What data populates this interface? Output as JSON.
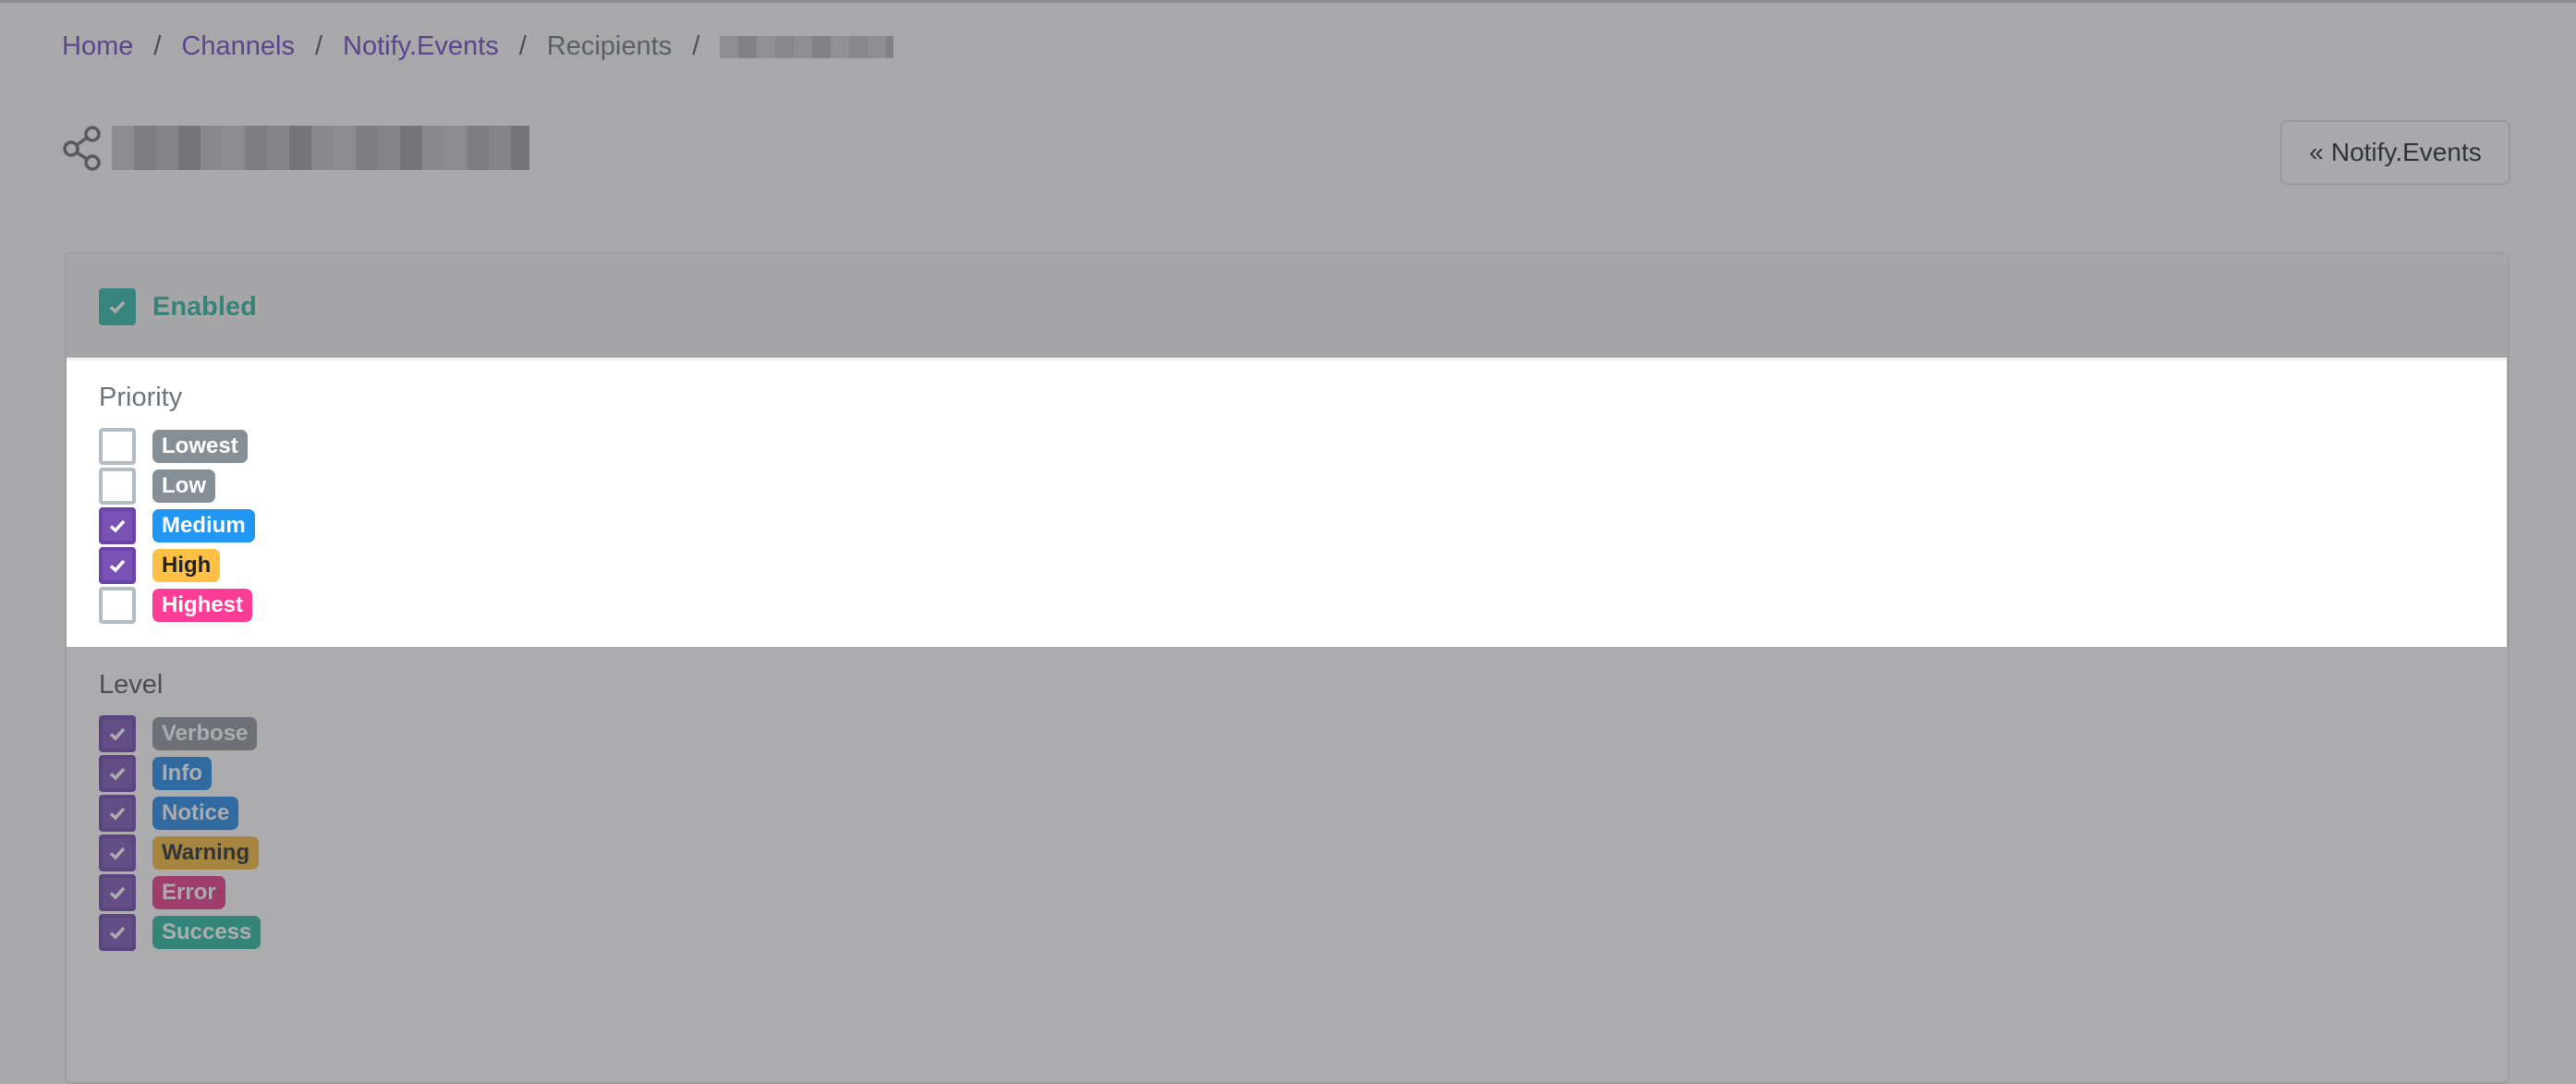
{
  "breadcrumb": {
    "items": [
      {
        "label": "Home",
        "link": true
      },
      {
        "label": "Channels",
        "link": true
      },
      {
        "label": "Notify.Events",
        "link": true
      },
      {
        "label": "Recipients",
        "link": false
      }
    ],
    "separator": "/"
  },
  "header": {
    "icon": "share-icon",
    "back_button_label": "Notify.Events",
    "back_button_icon": "«"
  },
  "card": {
    "enabled": {
      "label": "Enabled",
      "checked": true,
      "color": "#2ab9a4"
    },
    "priority": {
      "title": "Priority",
      "options": [
        {
          "label": "Lowest",
          "checked": false,
          "color": "#868e96",
          "text_color": "#ffffff"
        },
        {
          "label": "Low",
          "checked": false,
          "color": "#868e96",
          "text_color": "#ffffff"
        },
        {
          "label": "Medium",
          "checked": true,
          "color": "#2196f3",
          "text_color": "#ffffff"
        },
        {
          "label": "High",
          "checked": true,
          "color": "#ffc145",
          "text_color": "#212529"
        },
        {
          "label": "Highest",
          "checked": false,
          "color": "#ff3d97",
          "text_color": "#ffffff"
        }
      ]
    },
    "level": {
      "title": "Level",
      "options": [
        {
          "label": "Verbose",
          "checked": true,
          "color": "#8c949b",
          "text_color": "#ffffff"
        },
        {
          "label": "Info",
          "checked": true,
          "color": "#1e88e5",
          "text_color": "#ffffff"
        },
        {
          "label": "Notice",
          "checked": true,
          "color": "#1e88e5",
          "text_color": "#ffffff"
        },
        {
          "label": "Warning",
          "checked": true,
          "color": "#f5b83a",
          "text_color": "#212529"
        },
        {
          "label": "Error",
          "checked": true,
          "color": "#e63585",
          "text_color": "#ffffff"
        },
        {
          "label": "Success",
          "checked": true,
          "color": "#24b99f",
          "text_color": "#ffffff"
        }
      ]
    }
  },
  "colors": {
    "accent": "#6f42c1",
    "checkbox_on": "#7952b3"
  }
}
